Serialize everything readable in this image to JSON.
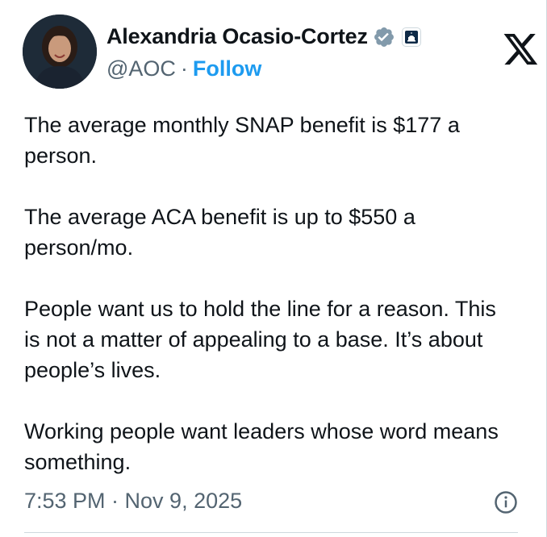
{
  "author": {
    "display_name": "Alexandria Ocasio-Cortez",
    "handle": "@AOC",
    "separator": "·",
    "follow_label": "Follow",
    "avatar_icon": "avatar-photo",
    "verified_icon": "verified-badge-icon",
    "affiliation_icon": "capitol-affiliation-icon"
  },
  "platform_icon": "x-logo-icon",
  "post": {
    "paragraphs": [
      "The average monthly SNAP benefit is $177 a person.",
      "The average ACA benefit is up to $550 a person/mo.",
      "People want us to hold the line for a reason. This is not a matter of appealing to a base. It’s about people’s lives.",
      "Working people want leaders whose word means something."
    ],
    "timestamp": "7:53 PM · Nov 9, 2025"
  },
  "colors": {
    "text": "#0f1419",
    "secondary": "#536471",
    "accent": "#1d9bf0",
    "verified": "#829aab"
  }
}
